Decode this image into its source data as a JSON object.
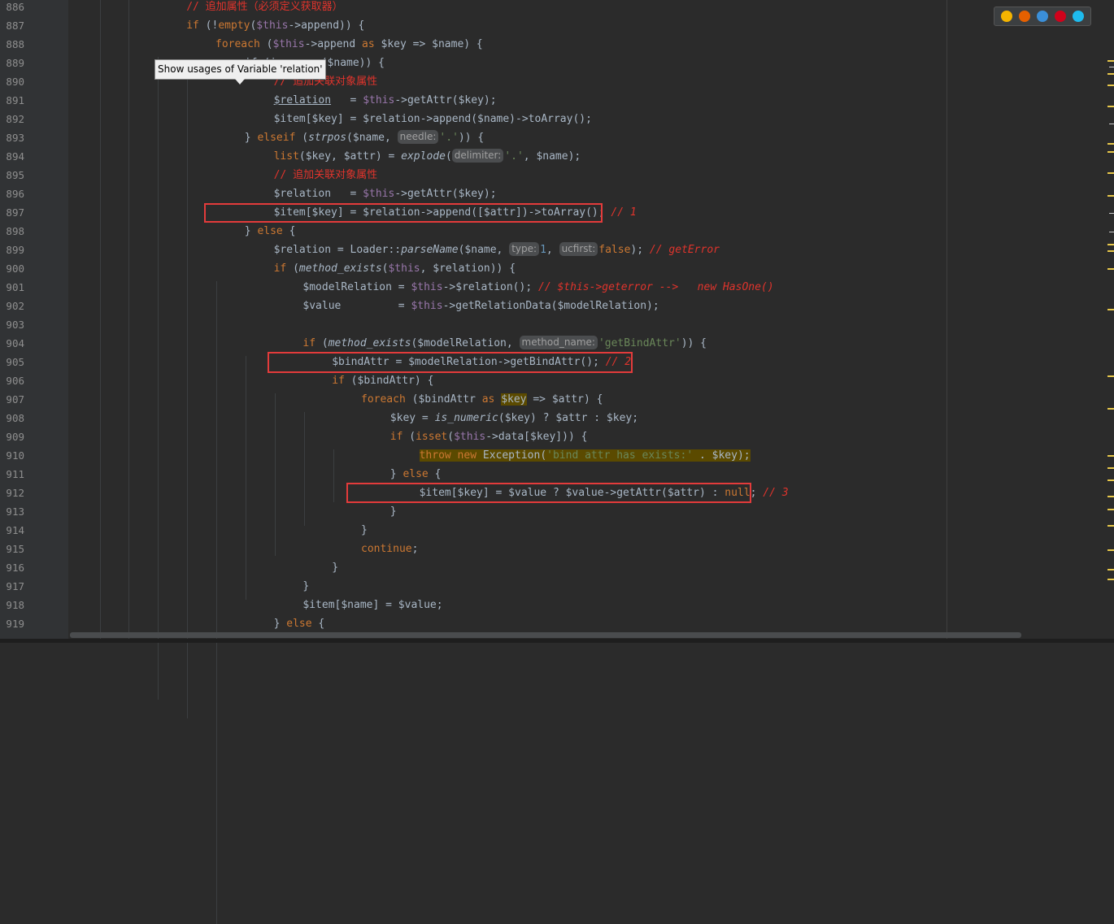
{
  "editor": {
    "tooltip": "Show usages of Variable 'relation'",
    "browser_icons": [
      {
        "name": "chrome",
        "color": "#f4b400"
      },
      {
        "name": "firefox",
        "color": "#e66000"
      },
      {
        "name": "safari",
        "color": "#3b8fd8"
      },
      {
        "name": "opera",
        "color": "#d0021b"
      },
      {
        "name": "ie",
        "color": "#1ebbee"
      }
    ],
    "lines": [
      {
        "n": "886",
        "indent": 4,
        "tokens": [
          {
            "t": "// 追加属性（必须定义获取器）",
            "c": "cm"
          }
        ]
      },
      {
        "n": "887",
        "indent": 4,
        "tokens": [
          {
            "t": "if",
            "c": "kw"
          },
          {
            "t": " (!"
          },
          {
            "t": "empty",
            "c": "kw"
          },
          {
            "t": "("
          },
          {
            "t": "$this",
            "c": "var"
          },
          {
            "t": "->append)) {"
          }
        ]
      },
      {
        "n": "888",
        "indent": 5,
        "tokens": [
          {
            "t": "foreach",
            "c": "kw"
          },
          {
            "t": " ("
          },
          {
            "t": "$this",
            "c": "var"
          },
          {
            "t": "->append "
          },
          {
            "t": "as",
            "c": "kw"
          },
          {
            "t": " $key => $name) {"
          }
        ]
      },
      {
        "n": "889",
        "indent": 6,
        "tokens": [
          {
            "t": "if (is_array($name)) {"
          }
        ]
      },
      {
        "n": "890",
        "indent": 7,
        "tokens": [
          {
            "t": "// 追加关联对象属性",
            "c": "cm"
          }
        ]
      },
      {
        "n": "891",
        "indent": 7,
        "tokens": [
          {
            "t": "$relation",
            "c": "ul"
          },
          {
            "t": "   = "
          },
          {
            "t": "$this",
            "c": "var"
          },
          {
            "t": "->getAttr($key);"
          }
        ]
      },
      {
        "n": "892",
        "indent": 7,
        "tokens": [
          {
            "t": "$item[$key] = $relation->append($name)->toArray();"
          }
        ]
      },
      {
        "n": "893",
        "indent": 6,
        "tokens": [
          {
            "t": "} "
          },
          {
            "t": "elseif",
            "c": "kw"
          },
          {
            "t": " ("
          },
          {
            "t": "strpos",
            "c": "it"
          },
          {
            "t": "($name, "
          },
          {
            "t": "needle:",
            "c": "hint"
          },
          {
            "t": "'.'",
            "c": "str"
          },
          {
            "t": ")) {"
          }
        ]
      },
      {
        "n": "894",
        "indent": 7,
        "tokens": [
          {
            "t": "list",
            "c": "kw"
          },
          {
            "t": "($key, $attr) = "
          },
          {
            "t": "explode",
            "c": "it"
          },
          {
            "t": "("
          },
          {
            "t": "delimiter:",
            "c": "hint"
          },
          {
            "t": "'.'",
            "c": "str"
          },
          {
            "t": ", $name);"
          }
        ]
      },
      {
        "n": "895",
        "indent": 7,
        "tokens": [
          {
            "t": "// 追加关联对象属性",
            "c": "cm"
          }
        ]
      },
      {
        "n": "896",
        "indent": 7,
        "tokens": [
          {
            "t": "$relation   = "
          },
          {
            "t": "$this",
            "c": "var"
          },
          {
            "t": "->getAttr($key);"
          }
        ]
      },
      {
        "n": "897",
        "indent": 7,
        "tokens": [
          {
            "t": "$item[$key] = $relation->append([$attr])->toArray();"
          },
          {
            "t": " // 1",
            "c": "cmi"
          }
        ]
      },
      {
        "n": "898",
        "indent": 6,
        "tokens": [
          {
            "t": "} "
          },
          {
            "t": "else",
            "c": "kw"
          },
          {
            "t": " {"
          }
        ]
      },
      {
        "n": "899",
        "indent": 7,
        "tokens": [
          {
            "t": "$relation = Loader::"
          },
          {
            "t": "parseName",
            "c": "it"
          },
          {
            "t": "($name, "
          },
          {
            "t": "type:",
            "c": "hint"
          },
          {
            "t": "1",
            "c": "num"
          },
          {
            "t": ", "
          },
          {
            "t": "ucfirst:",
            "c": "hint"
          },
          {
            "t": "false",
            "c": "kw"
          },
          {
            "t": "); "
          },
          {
            "t": "// getError",
            "c": "cmi"
          }
        ]
      },
      {
        "n": "900",
        "indent": 7,
        "tokens": [
          {
            "t": "if",
            "c": "kw"
          },
          {
            "t": " ("
          },
          {
            "t": "method_exists",
            "c": "it"
          },
          {
            "t": "("
          },
          {
            "t": "$this",
            "c": "var"
          },
          {
            "t": ", $relation)) {"
          }
        ]
      },
      {
        "n": "901",
        "indent": 8,
        "tokens": [
          {
            "t": "$modelRelation = "
          },
          {
            "t": "$this",
            "c": "var"
          },
          {
            "t": "->$relation(); "
          },
          {
            "t": "// $this->geterror -->   new HasOne()",
            "c": "cmi"
          }
        ]
      },
      {
        "n": "902",
        "indent": 8,
        "tokens": [
          {
            "t": "$value         = "
          },
          {
            "t": "$this",
            "c": "var"
          },
          {
            "t": "->getRelationData($modelRelation);"
          }
        ]
      },
      {
        "n": "903",
        "indent": 0,
        "tokens": []
      },
      {
        "n": "904",
        "indent": 8,
        "tokens": [
          {
            "t": "if",
            "c": "kw"
          },
          {
            "t": " ("
          },
          {
            "t": "method_exists",
            "c": "it"
          },
          {
            "t": "($modelRelation, "
          },
          {
            "t": "method_name:",
            "c": "hint"
          },
          {
            "t": "'getBindAttr'",
            "c": "str"
          },
          {
            "t": ")) {"
          }
        ]
      },
      {
        "n": "905",
        "indent": 9,
        "tokens": [
          {
            "t": "$bindAttr = $modelRelation->getBindAttr(); "
          },
          {
            "t": "// 2",
            "c": "cmi"
          }
        ]
      },
      {
        "n": "906",
        "indent": 9,
        "tokens": [
          {
            "t": "if",
            "c": "kw"
          },
          {
            "t": " ($bindAttr) {"
          }
        ]
      },
      {
        "n": "907",
        "indent": 10,
        "tokens": [
          {
            "t": "foreach",
            "c": "kw"
          },
          {
            "t": " ($bindAttr "
          },
          {
            "t": "as",
            "c": "kw"
          },
          {
            "t": " "
          },
          {
            "t": "$key",
            "c": "hl"
          },
          {
            "t": " => $attr) {"
          }
        ]
      },
      {
        "n": "908",
        "indent": 11,
        "tokens": [
          {
            "t": "$key = "
          },
          {
            "t": "is_numeric",
            "c": "it"
          },
          {
            "t": "($key) ? $attr : $key;"
          }
        ]
      },
      {
        "n": "909",
        "indent": 11,
        "tokens": [
          {
            "t": "if",
            "c": "kw"
          },
          {
            "t": " ("
          },
          {
            "t": "isset",
            "c": "kw"
          },
          {
            "t": "("
          },
          {
            "t": "$this",
            "c": "var"
          },
          {
            "t": "->data[$key])) {"
          }
        ]
      },
      {
        "n": "910",
        "indent": 12,
        "tokens": [
          {
            "t": "throw new",
            "c": "kw hl"
          },
          {
            "t": " Exception(",
            "c": "hl"
          },
          {
            "t": "'bind attr has exists:'",
            "c": "str hl"
          },
          {
            "t": " . $key);",
            "c": "hl"
          }
        ]
      },
      {
        "n": "911",
        "indent": 11,
        "tokens": [
          {
            "t": "} "
          },
          {
            "t": "else",
            "c": "kw"
          },
          {
            "t": " {"
          }
        ]
      },
      {
        "n": "912",
        "indent": 12,
        "tokens": [
          {
            "t": "$item[$key] = $value ? $value->getAttr($attr) : "
          },
          {
            "t": "null",
            "c": "kw"
          },
          {
            "t": ";"
          },
          {
            "t": " // 3",
            "c": "cmi"
          }
        ]
      },
      {
        "n": "913",
        "indent": 11,
        "tokens": [
          {
            "t": "}"
          }
        ]
      },
      {
        "n": "914",
        "indent": 10,
        "tokens": [
          {
            "t": "}"
          }
        ]
      },
      {
        "n": "915",
        "indent": 10,
        "tokens": [
          {
            "t": "continue",
            "c": "kw"
          },
          {
            "t": ";"
          }
        ]
      },
      {
        "n": "916",
        "indent": 9,
        "tokens": [
          {
            "t": "}"
          }
        ]
      },
      {
        "n": "917",
        "indent": 8,
        "tokens": [
          {
            "t": "}"
          }
        ]
      },
      {
        "n": "918",
        "indent": 8,
        "tokens": [
          {
            "t": "$item[$name] = $value;"
          }
        ]
      },
      {
        "n": "919",
        "indent": 7,
        "tokens": [
          {
            "t": "} "
          },
          {
            "t": "else",
            "c": "kw"
          },
          {
            "t": " {"
          }
        ]
      }
    ]
  }
}
